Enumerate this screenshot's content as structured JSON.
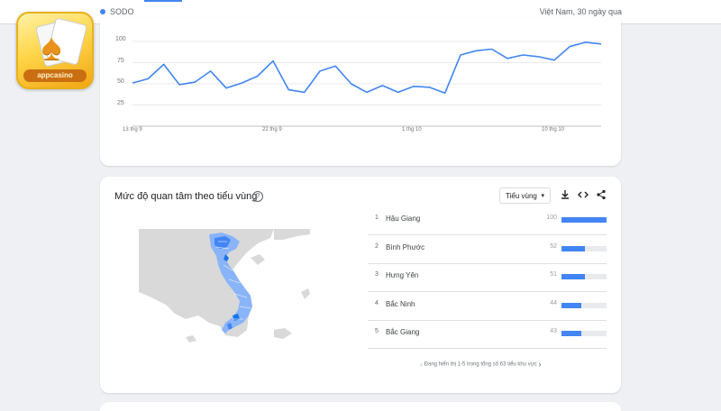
{
  "header": {
    "search_term": "SODO",
    "meta": "Việt Nam, 30 ngày qua"
  },
  "logo": {
    "text": "appcasino",
    "glyph": "♠"
  },
  "chart_data": {
    "type": "line",
    "ylim": [
      0,
      100
    ],
    "yticks": [
      "100",
      "75",
      "50",
      "25"
    ],
    "xticks": [
      "13 thg 9",
      "22 thg 9",
      "1 thg 10",
      "10 thg 10"
    ],
    "series": [
      {
        "values": [
          51,
          56,
          73,
          49,
          52,
          65,
          45,
          51,
          59,
          77,
          43,
          40,
          65,
          71,
          50,
          40,
          48,
          40,
          47,
          46,
          39,
          84,
          89,
          91,
          80,
          84,
          82,
          78,
          94,
          99,
          97
        ]
      }
    ],
    "color": "#4285f4"
  },
  "region": {
    "title": "Mức độ quan tâm theo tiểu vùng",
    "help_icon": "?",
    "dropdown_value": "Tiểu vùng",
    "icons": {
      "download": "download-icon",
      "embed": "embed-icon",
      "share": "share-icon"
    },
    "rows": [
      {
        "rank": "1",
        "name": "Hậu Giang",
        "value": "100",
        "level": 100
      },
      {
        "rank": "2",
        "name": "Bình Phước",
        "value": "52",
        "level": 52
      },
      {
        "rank": "3",
        "name": "Hưng Yên",
        "value": "51",
        "level": 51
      },
      {
        "rank": "4",
        "name": "Bắc Ninh",
        "value": "44",
        "level": 44
      },
      {
        "rank": "5",
        "name": "Bắc Giang",
        "value": "43",
        "level": 43
      }
    ],
    "pager_text": "Đang hiển thị 1-5 trong tổng số 63 tiểu khu vực"
  }
}
